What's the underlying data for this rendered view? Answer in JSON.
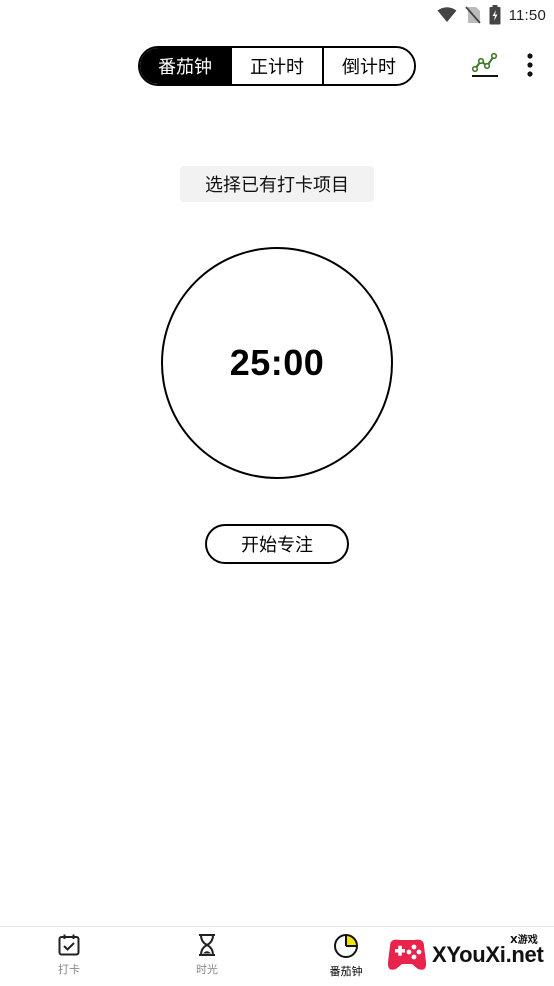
{
  "status_bar": {
    "time": "11:50"
  },
  "tabs": [
    {
      "label": "番茄钟",
      "active": true
    },
    {
      "label": "正计时",
      "active": false
    },
    {
      "label": "倒计时",
      "active": false
    }
  ],
  "actions": {
    "stats_icon": "line-chart-icon",
    "more_icon": "more-vertical-icon"
  },
  "project_select": {
    "label": "选择已有打卡项目"
  },
  "timer": {
    "display": "25:00"
  },
  "start_button": {
    "label": "开始专注"
  },
  "bottom_nav": [
    {
      "label": "打卡",
      "icon": "calendar-check-icon",
      "active": false
    },
    {
      "label": "时光",
      "icon": "hourglass-icon",
      "active": false
    },
    {
      "label": "番茄钟",
      "icon": "pie-clock-icon",
      "active": true
    }
  ],
  "watermark": {
    "text": "XYouXi.net",
    "badge": "X游戏"
  },
  "colors": {
    "primary": "#000000",
    "background": "#ffffff",
    "select_bg": "#f2f2f2",
    "accent_yellow": "#f5e400",
    "chart_icon_green": "#3f7a2a",
    "watermark_red": "#e8244c"
  }
}
